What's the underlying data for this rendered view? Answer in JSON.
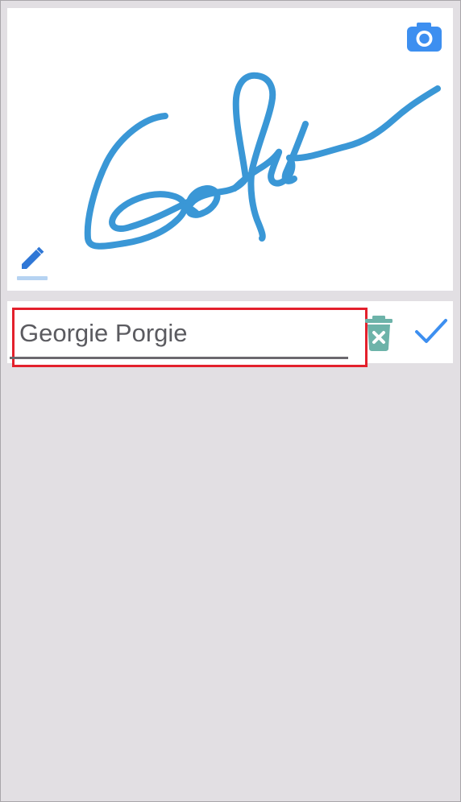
{
  "signature": {
    "name_value": "Georgie Porgie",
    "stroke_color": "#3a97d6"
  },
  "icons": {
    "camera": "camera-icon",
    "pen": "pen-icon",
    "trash": "trash-icon",
    "check": "check-icon"
  },
  "colors": {
    "accent": "#3a97d6",
    "camera_bg": "#3d8ff0",
    "trash": "#6db3a9",
    "check": "#3d8ff0",
    "highlight": "#e3202c"
  }
}
